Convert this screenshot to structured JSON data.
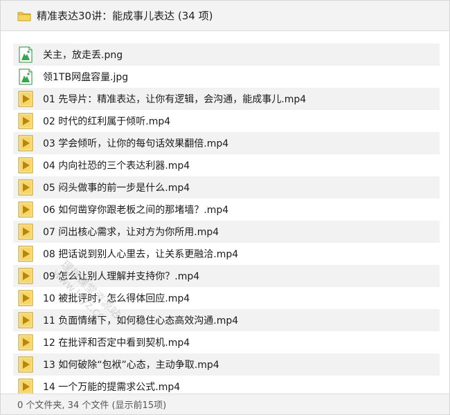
{
  "window": {
    "title": "精准表达30讲：能成事儿表达 (34 项)"
  },
  "files": [
    {
      "name": "关主，放走丢.png",
      "icon": "image-file-icon"
    },
    {
      "name": "领1TB网盘容量.jpg",
      "icon": "image-file-icon"
    },
    {
      "name": "01 先导片：精准表达，让你有逻辑，会沟通，能成事儿.mp4",
      "icon": "video-file-icon"
    },
    {
      "name": "02 时代的红利属于倾听.mp4",
      "icon": "video-file-icon"
    },
    {
      "name": "03 学会倾听，让你的每句话效果翻倍.mp4",
      "icon": "video-file-icon"
    },
    {
      "name": "04 内向社恐的三个表达利器.mp4",
      "icon": "video-file-icon"
    },
    {
      "name": "05 闷头做事的前一步是什么.mp4",
      "icon": "video-file-icon"
    },
    {
      "name": "06 如何凿穿你跟老板之间的那堵墙？.mp4",
      "icon": "video-file-icon"
    },
    {
      "name": "07 问出核心需求，让对方为你所用.mp4",
      "icon": "video-file-icon"
    },
    {
      "name": "08 把话说到别人心里去，让关系更融洽.mp4",
      "icon": "video-file-icon"
    },
    {
      "name": "09 怎么让别人理解并支持你？.mp4",
      "icon": "video-file-icon"
    },
    {
      "name": "10 被批评时，怎么得体回应.mp4",
      "icon": "video-file-icon"
    },
    {
      "name": "11 负面情绪下，如何稳住心态高效沟通.mp4",
      "icon": "video-file-icon"
    },
    {
      "name": "12 在批评和否定中看到契机.mp4",
      "icon": "video-file-icon"
    },
    {
      "name": "13 如何破除“包袱”心态，主动争取.mp4",
      "icon": "video-file-icon"
    },
    {
      "name": "14 一个万能的提需求公式.mp4",
      "icon": "video-file-icon"
    }
  ],
  "status": {
    "text": "0 个文件夹, 34 个文件 (显示前15项)"
  },
  "watermark": {
    "line1": "理想课堂资源站",
    "line2": "www.lxyz.cc"
  },
  "colors": {
    "folder": "#f5c842",
    "video_icon": "#d4a017",
    "image_icon": "#2fa84f",
    "row_alt": "#f2f2f2"
  }
}
